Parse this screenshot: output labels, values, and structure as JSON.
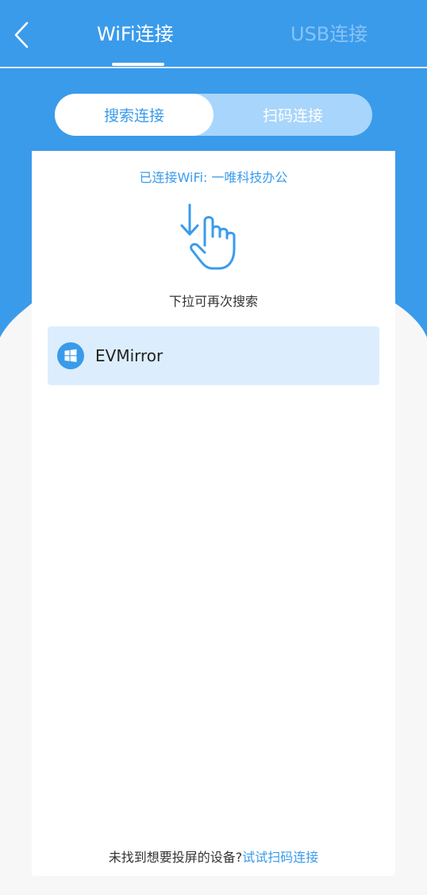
{
  "colors": {
    "primary": "#3A9BEB",
    "segment_track": "#A8D5FB",
    "device_highlight": "#DCEEFE",
    "background": "#F7F7F8"
  },
  "header": {
    "back_icon": "chevron-left-icon",
    "tabs": [
      {
        "label": "WiFi连接",
        "active": true
      },
      {
        "label": "USB连接",
        "active": false
      }
    ]
  },
  "segment": {
    "options": [
      {
        "label": "搜索连接",
        "active": true
      },
      {
        "label": "扫码连接",
        "active": false
      }
    ]
  },
  "card": {
    "wifi_status": "已连接WiFi: 一唯科技办公",
    "pull_icon": "pull-down-hand-icon",
    "pull_hint": "下拉可再次搜索",
    "devices": [
      {
        "name": "EVMirror",
        "icon": "windows-icon"
      }
    ],
    "footer": {
      "question": "未找到想要投屏的设备?",
      "link": "试试扫码连接"
    }
  }
}
